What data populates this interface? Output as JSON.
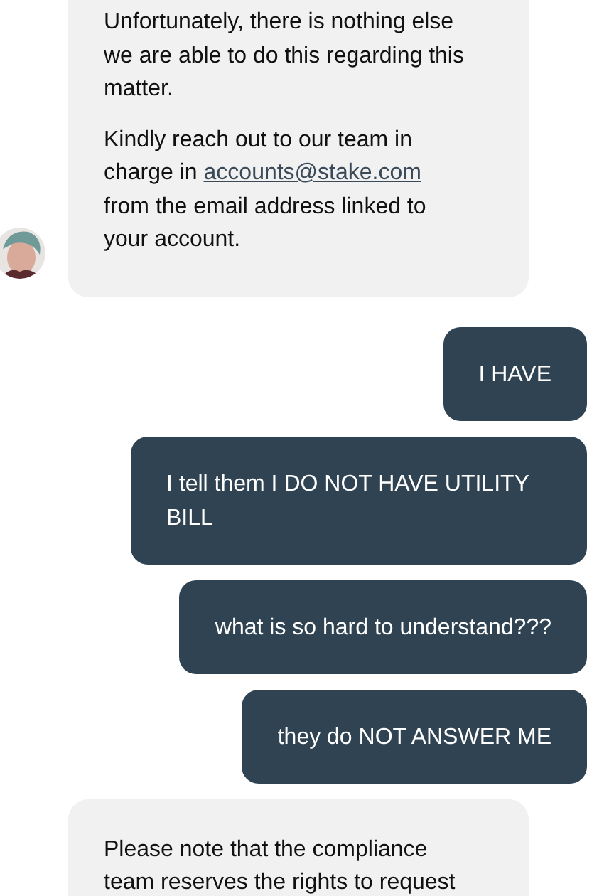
{
  "messages": [
    {
      "kind": "incoming",
      "avatar": true,
      "paragraphs": [
        {
          "text": "Unfortunately, there is nothing else we are able to do this regarding this matter."
        },
        {
          "text": "Kindly reach out to our team in charge in ",
          "link": "accounts@stake.com",
          "after": " from the email address linked to your account."
        }
      ]
    },
    {
      "kind": "outgoing",
      "text": "I HAVE"
    },
    {
      "kind": "outgoing",
      "text": "I tell them I DO NOT HAVE UTILITY BILL"
    },
    {
      "kind": "outgoing",
      "text": "what is so hard to understand???"
    },
    {
      "kind": "outgoing",
      "text": "they do NOT ANSWER ME"
    },
    {
      "kind": "incoming",
      "avatar": false,
      "paragraphs": [
        {
          "text": "Please note that the compliance team reserves the rights to request"
        }
      ]
    }
  ]
}
